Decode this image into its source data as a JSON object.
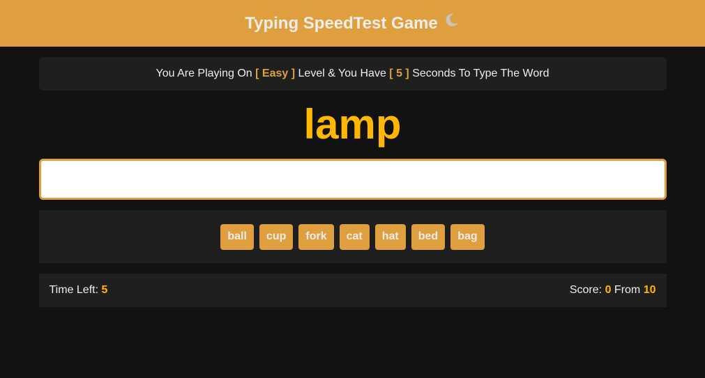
{
  "header": {
    "title": "Typing SpeedTest Game",
    "icon": "moon-icon"
  },
  "message": {
    "prefix": "You Are Playing On",
    "level": "[ Easy ]",
    "middle": "Level & You Have",
    "seconds": "[ 5 ]",
    "suffix": "Seconds To Type The Word"
  },
  "current_word": "lamp",
  "input": {
    "value": "",
    "placeholder": ""
  },
  "upcoming_words": [
    "ball",
    "cup",
    "fork",
    "cat",
    "hat",
    "bed",
    "bag"
  ],
  "controls": {
    "time_label": "Time Left:",
    "time_value": "5",
    "score_label": "Score:",
    "score_value": "0",
    "from_label": "From",
    "total_value": "10"
  },
  "colors": {
    "accent": "#e09f3e",
    "highlight": "#ffb703",
    "background": "#121212",
    "panel": "#1f1f1f"
  }
}
